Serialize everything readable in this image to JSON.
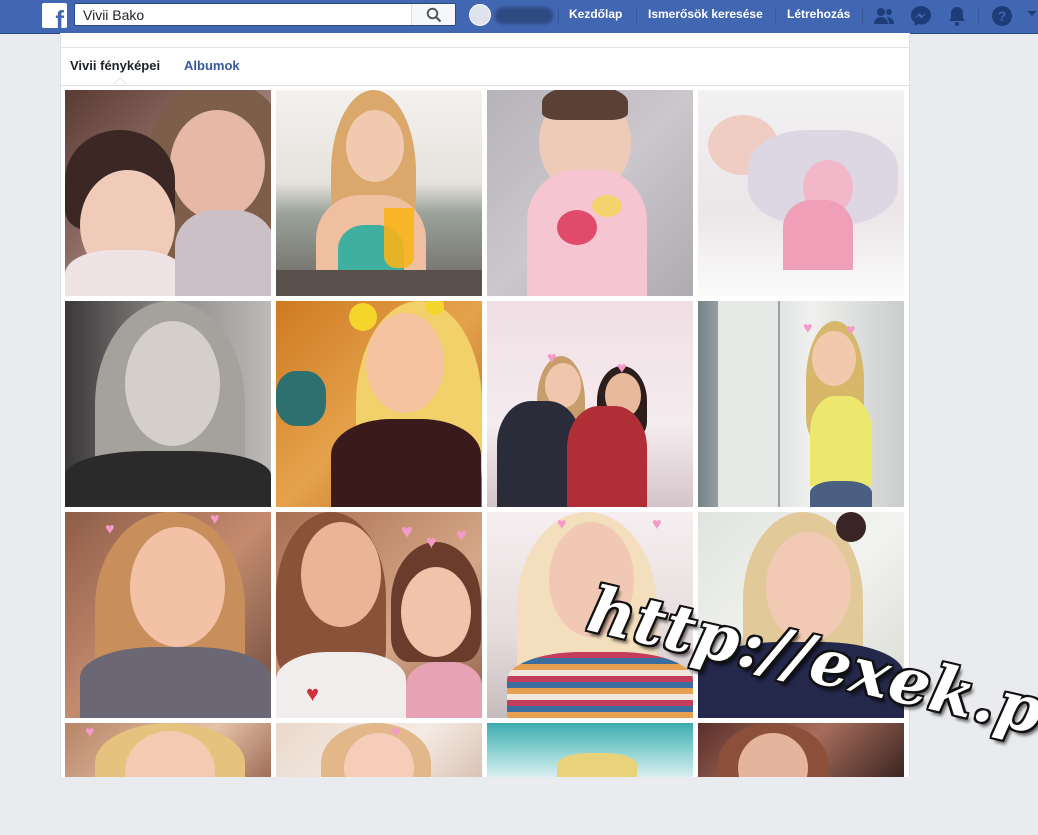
{
  "topbar": {
    "search_value": "Vivii Bako",
    "nav_links": [
      "Kezdőlap",
      "Ismerősök keresése",
      "Létrehozás"
    ],
    "icons": [
      "facebook-logo-icon",
      "search-icon",
      "friend-requests-icon",
      "messenger-icon",
      "notifications-icon",
      "help-icon",
      "dropdown-caret-icon"
    ]
  },
  "tabs": {
    "photos_label": "Vivii fényképei",
    "albums_label": "Albumok"
  },
  "photos": [
    {
      "desc": "woman-and-baby"
    },
    {
      "desc": "girl-at-cafe-with-juice"
    },
    {
      "desc": "baby-in-pink"
    },
    {
      "desc": "sleeping-newborn-with-bunny"
    },
    {
      "desc": "selfie-black-and-white"
    },
    {
      "desc": "selfie-with-crown-filter"
    },
    {
      "desc": "two-girls-with-flower-crowns"
    },
    {
      "desc": "girl-in-yellow-top"
    },
    {
      "desc": "selfie-with-hearts"
    },
    {
      "desc": "girl-and-child-with-hearts"
    },
    {
      "desc": "selfie-striped-sweater"
    },
    {
      "desc": "selfie-with-flower"
    },
    {
      "desc": "selfie-row4-1"
    },
    {
      "desc": "selfie-row4-2"
    },
    {
      "desc": "photo-row4-3"
    },
    {
      "desc": "photo-row4-4"
    }
  ],
  "watermark": "http://exek.pw"
}
